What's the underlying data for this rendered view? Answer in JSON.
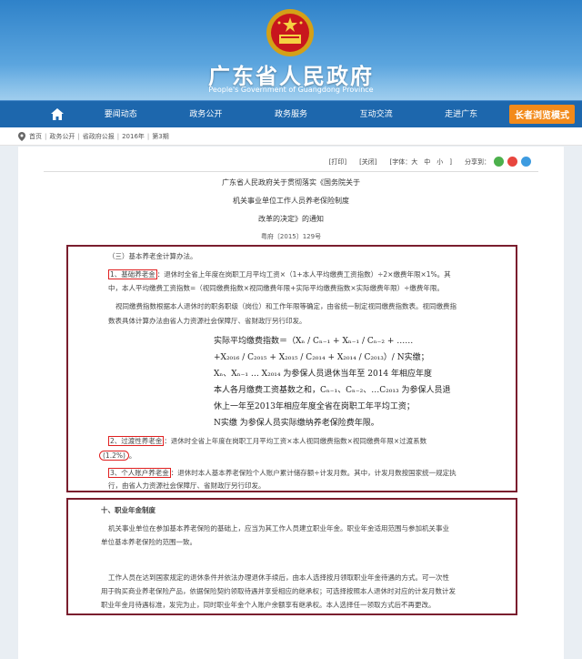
{
  "site": {
    "title": "广东省人民政府",
    "subtitle": "People's Government of Guangdong Province"
  },
  "nav": {
    "items": [
      "要闻动态",
      "政务公开",
      "政务服务",
      "互动交流",
      "走进广东"
    ],
    "elder_mode": "长者浏览模式"
  },
  "breadcrumb": [
    "首页",
    "政务公开",
    "省政府公报",
    "2016年",
    "第3期"
  ],
  "toolbar": {
    "print": "[打印]",
    "close": "[关闭]",
    "font": "[字体：大　中　小　]",
    "share": "分享到："
  },
  "doc": {
    "title_lines": [
      "广东省人民政府关于贯彻落实《国务院关于",
      "机关事业单位工作人员养老保险制度",
      "改革的决定》的通知"
    ],
    "number": "粤府〔2015〕129号"
  },
  "section1": {
    "heading": "（三）基本养老金计算办法。",
    "item1_tag": "1、基础养老金",
    "item1_text_a": "：退休时全省上年度在岗职工月平均工资×（1+本人平均缴费工资指数）÷2×缴费年限×1%。其",
    "item1_text_b": "中，本人平均缴费工资指数=（视同缴费指数×视同缴费年限+实际平均缴费指数×实际缴费年限）÷缴费年限。",
    "para2_a": "视同缴费指数根据本人退休时的职务职级（岗位）和工作年限等确定，由省统一制定视同缴费指数表。视同缴费指",
    "para2_b": "数表具体计算办法由省人力资源社会保障厅、省财政厅另行印发。",
    "formula_lines": [
      "实际平均缴费指数＝（Xₙ / Cₙ₋₁ + Xₙ₋₁ / Cₙ₋₂ + ……",
      "+X₂₀₁₆ / C₂₀₁₅ + X₂₀₁₅ / C₂₀₁₄ + X₂₀₁₄ / C₂₀₁₃）/ N实缴；",
      "Xₙ、Xₙ₋₁ … X₂₀₁₄ 为参保人员退休当年至 2014 年相应年度",
      "本人各月缴费工资基数之和，Cₙ₋₁、Cₙ₋₂、…C₂₀₁₃ 为参保人员退",
      "休上一年至2013年相应年度全省在岗职工年平均工资；",
      "N实缴 为参保人员实际缴纳养老保险费年限。"
    ],
    "item2_tag": "2、过渡性养老金",
    "item2_text": "：退休时全省上年度在岗职工月平均工资×本人视同缴费指数×视同缴费年限×过渡系数",
    "item2_coef": "(1.2%)",
    "item2_end": "。",
    "item3_tag": "3、个人账户养老金",
    "item3_text_a": "：退休时本人基本养老保险个人账户累计储存额÷计发月数。其中，计发月数按国家统一规定执",
    "item3_text_b": "行，由省人力资源社会保障厅、省财政厅另行印发。"
  },
  "section2": {
    "heading": "十、职业年金制度",
    "para1_a": "机关事业单位在参加基本养老保险的基础上，应当为其工作人员建立职业年金。职业年金适用范围与参加机关事业",
    "para1_b": "单位基本养老保险的范围一致。",
    "para2_a": "工作人员在达到国家规定的退休条件并依法办理退休手续后，由本人选择按月领取职业年金待遇的方式。可一次性",
    "para2_b": "用于购买商业养老保险产品，依据保险契约领取待遇并享受相应的继承权；可选择按照本人退休时对应的计发月数计发",
    "para2_c": "职业年金月待遇标准，发完为止，同时职业年金个人账户余额享有继承权。本人选择任一领取方式后不再更改。"
  },
  "colors": {
    "nav_bg": "#1d67ad",
    "elder_btn": "#f28a1a",
    "box_border": "#7a1e2e",
    "highlight": "#e02020"
  }
}
